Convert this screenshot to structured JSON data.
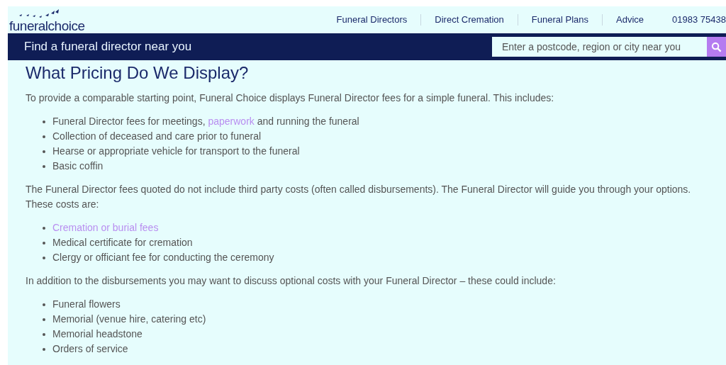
{
  "logo": {
    "text": "funeralchoice"
  },
  "nav": [
    {
      "label": "Funeral Directors"
    },
    {
      "label": "Direct Cremation"
    },
    {
      "label": "Funeral Plans"
    },
    {
      "label": "Advice"
    }
  ],
  "phone": "01983 75438",
  "search_bar": {
    "title": "Find a funeral director near you",
    "placeholder": "Enter a postcode, region or city near you"
  },
  "heading": "What Pricing Do We Display?",
  "blocks": [
    {
      "kind": "paragraph",
      "text": "To provide a comparable starting point, Funeral Choice displays Funeral Director fees for a simple funeral. This includes:"
    },
    {
      "kind": "list",
      "items": [
        [
          {
            "text": "Funeral Director fees for meetings, "
          },
          {
            "text": "paperwork",
            "kind": "link"
          },
          {
            "text": " and running the funeral"
          }
        ],
        [
          {
            "text": "Collection of deceased and care prior to funeral"
          }
        ],
        [
          {
            "text": "Hearse or appropriate vehicle for transport to the funeral"
          }
        ],
        [
          {
            "text": "Basic coffin"
          }
        ]
      ]
    },
    {
      "kind": "paragraph",
      "text": "The Funeral Director fees quoted do not include third party costs (often called disbursements). The Funeral Director will guide you through your options. These costs are:"
    },
    {
      "kind": "list",
      "items": [
        [
          {
            "text": "Cremation or burial fees",
            "kind": "link"
          }
        ],
        [
          {
            "text": "Medical certificate for cremation"
          }
        ],
        [
          {
            "text": "Clergy or officiant fee for conducting the ceremony"
          }
        ]
      ]
    },
    {
      "kind": "paragraph",
      "text": "In addition to the disbursements you may want to discuss optional costs with your Funeral Director – these could include:"
    },
    {
      "kind": "list",
      "items": [
        [
          {
            "text": "Funeral flowers"
          }
        ],
        [
          {
            "text": "Memorial (venue hire, catering etc)"
          }
        ],
        [
          {
            "text": "Memorial headstone"
          }
        ],
        [
          {
            "text": "Orders of service"
          }
        ]
      ]
    }
  ]
}
